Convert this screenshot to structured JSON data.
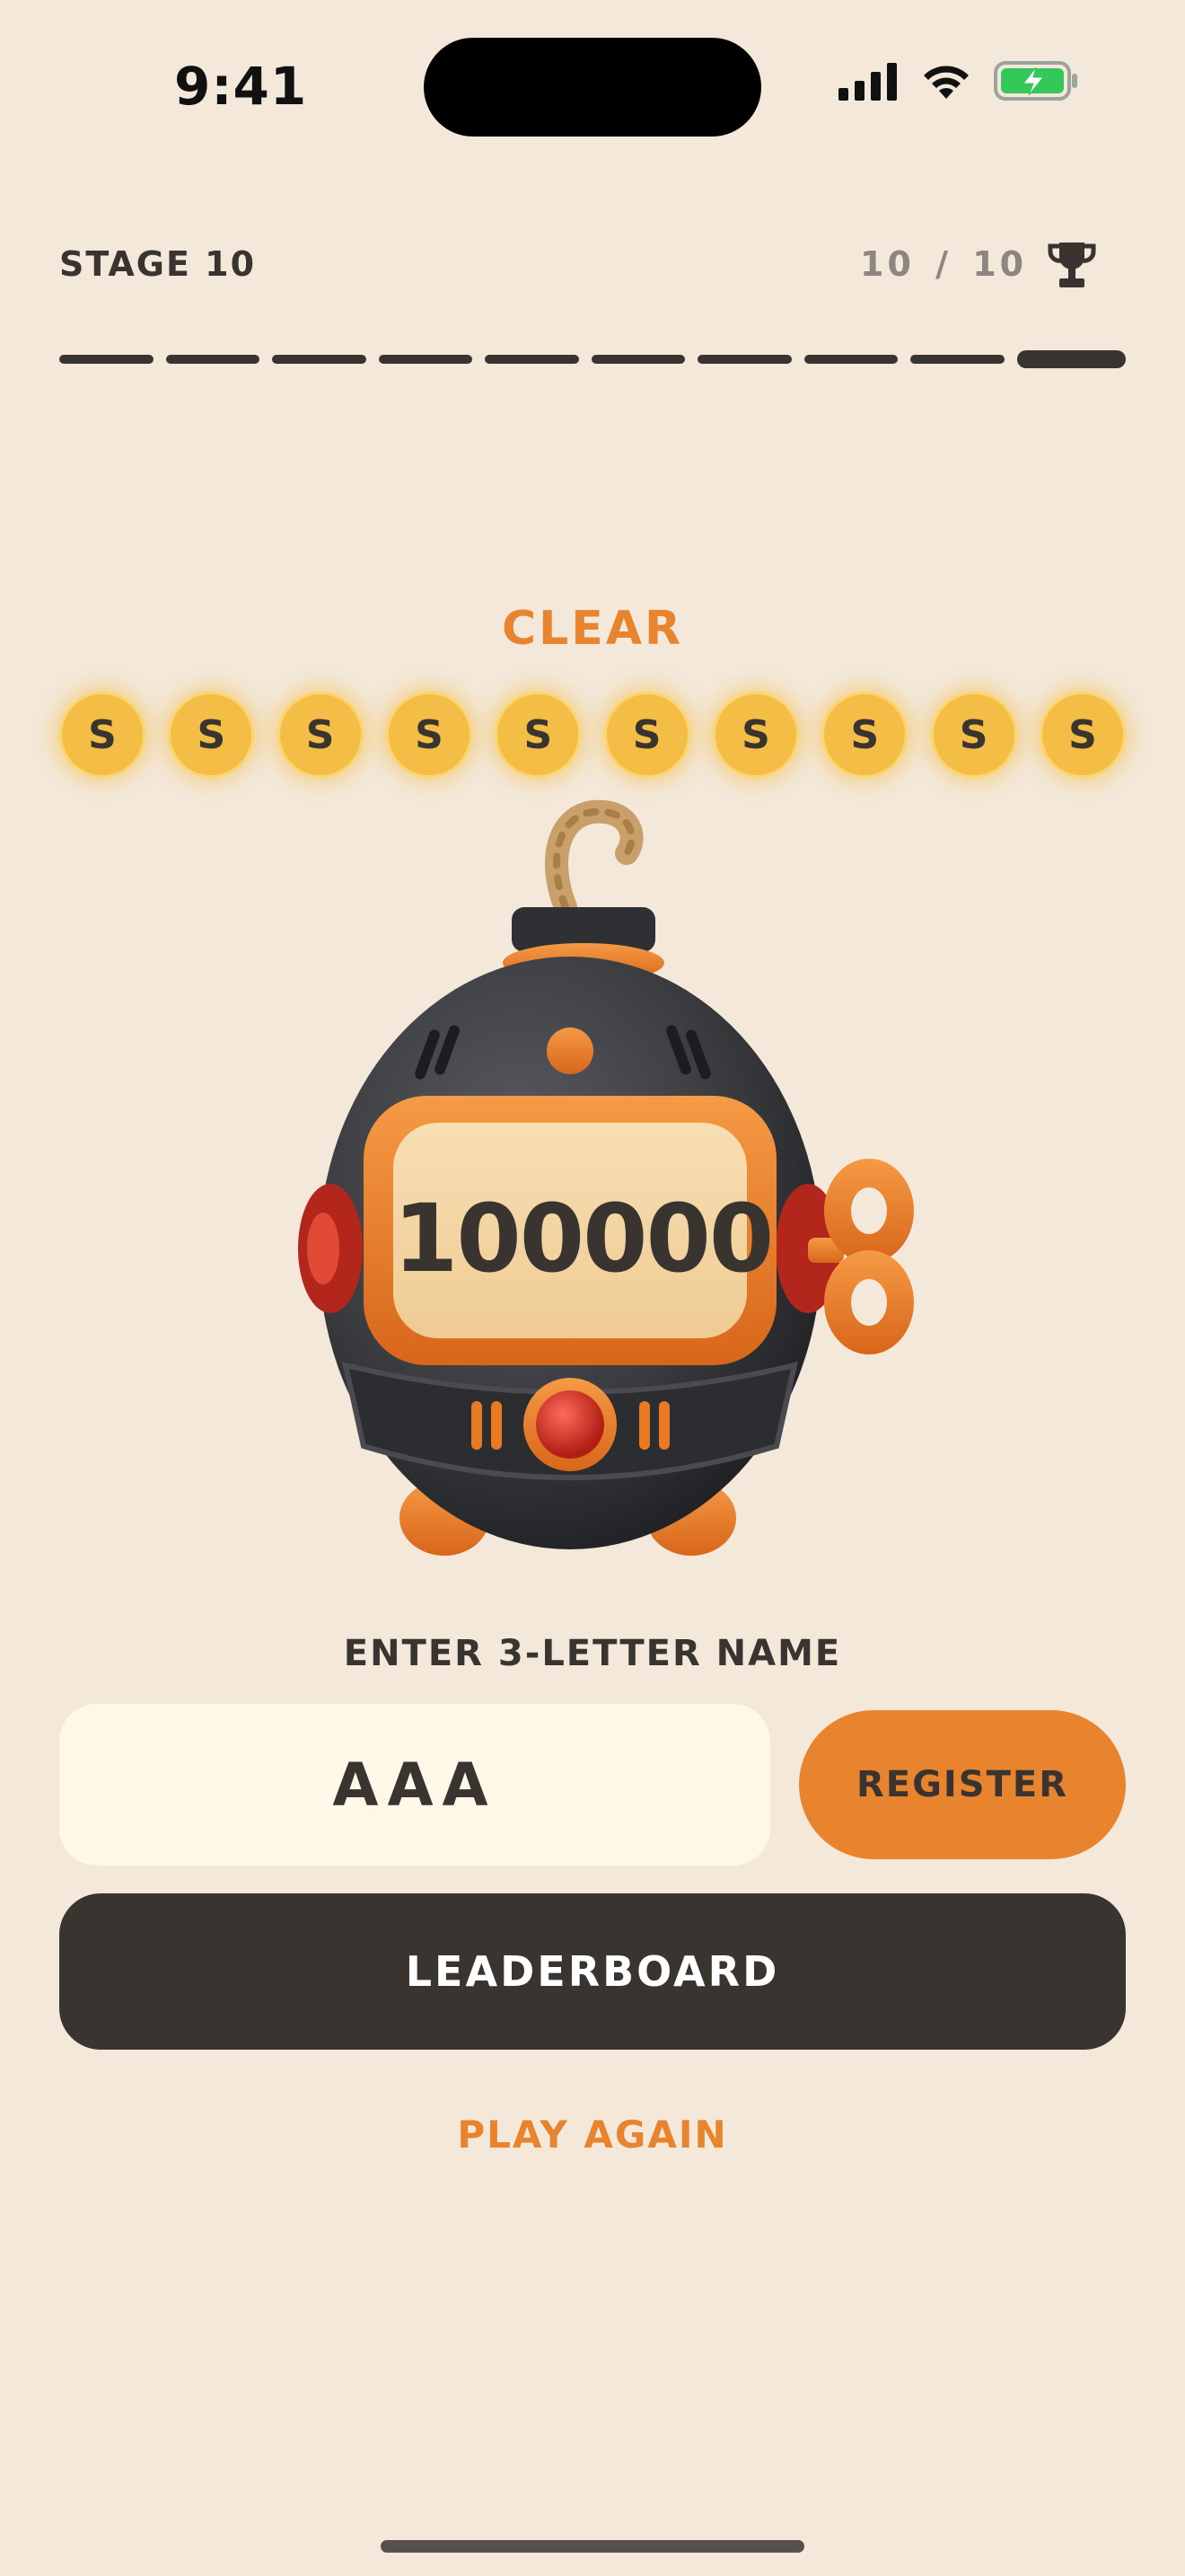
{
  "status_bar": {
    "time": "9:41",
    "battery_color": "#34C759"
  },
  "header": {
    "stage": "STAGE 10",
    "progress": "10 / 10",
    "total_segments": 10,
    "current_segment": 10,
    "trophy_icon": "trophy-icon"
  },
  "result": {
    "title": "CLEAR",
    "grades": [
      "S",
      "S",
      "S",
      "S",
      "S",
      "S",
      "S",
      "S",
      "S",
      "S"
    ],
    "score": "100000"
  },
  "name_entry": {
    "label": "ENTER 3-LETTER NAME",
    "value": "AAA",
    "register_label": "REGISTER"
  },
  "actions": {
    "leaderboard_label": "LEADERBOARD",
    "play_again_label": "PLAY AGAIN"
  },
  "colors": {
    "background": "#F3E8DA",
    "accent": "#E8832E",
    "dark": "#3A3431",
    "coin": "#F4BD45",
    "input_bg": "#FFF8E9"
  }
}
